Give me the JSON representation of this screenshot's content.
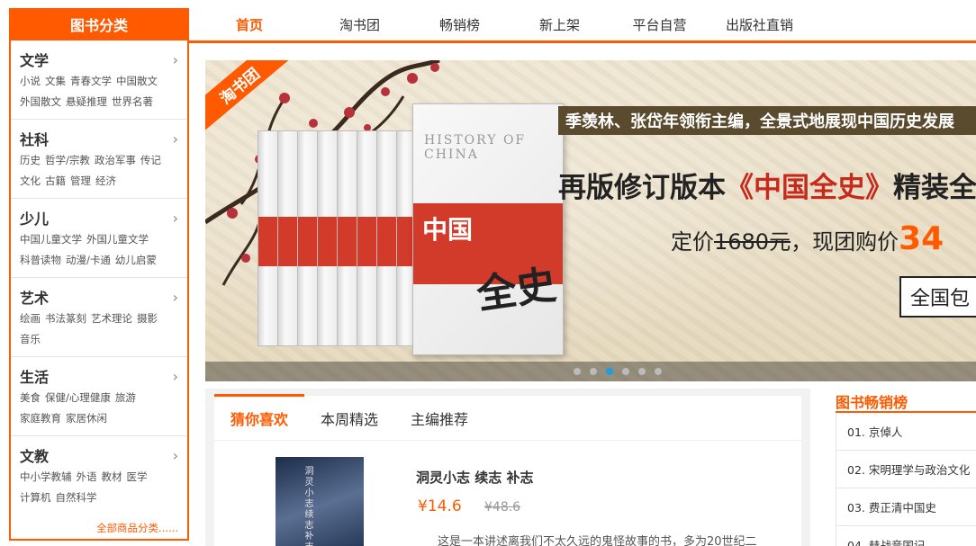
{
  "sidebar": {
    "header": "图书分类",
    "categories": [
      {
        "title": "文学",
        "links": [
          "小说",
          "文集",
          "青春文学",
          "中国散文",
          "外国散文",
          "悬疑推理",
          "世界名著"
        ]
      },
      {
        "title": "社科",
        "links": [
          "历史",
          "哲学/宗教",
          "政治军事",
          "传记",
          "文化",
          "古籍",
          "管理",
          "经济"
        ]
      },
      {
        "title": "少儿",
        "links": [
          "中国儿童文学",
          "外国儿童文学",
          "科普读物",
          "动漫/卡通",
          "幼儿启蒙"
        ]
      },
      {
        "title": "艺术",
        "links": [
          "绘画",
          "书法篆刻",
          "艺术理论",
          "摄影",
          "音乐"
        ]
      },
      {
        "title": "生活",
        "links": [
          "美食",
          "保健/心理健康",
          "旅游",
          "家庭教育",
          "家居休闲"
        ]
      },
      {
        "title": "文教",
        "links": [
          "中小学教辅",
          "外语",
          "教材",
          "医学",
          "计算机",
          "自然科学"
        ]
      }
    ],
    "all_link": "全部商品分类......"
  },
  "nav": {
    "items": [
      "首页",
      "淘书团",
      "畅销榜",
      "新上架",
      "平台自营",
      "出版社直销"
    ],
    "active_index": 0
  },
  "banner": {
    "ribbon": "淘书团",
    "line1": "季羡林、张岱年领衔主编，全景式地展现中国历史发展",
    "line2_prefix": "再版修订版本",
    "line2_title": "《中国全史》",
    "line2_suffix": "精装全",
    "line3_prefix": "定价",
    "line3_old": "1680元",
    "line3_mid": "，现团购价",
    "line3_new": "34",
    "button": "全国包",
    "book_en": "HISTORY OF CHINA",
    "book_zh": "中国",
    "book_zh2": "全史",
    "dots_count": 6,
    "active_dot": 2
  },
  "tabs": {
    "items": [
      "猜你喜欢",
      "本周精选",
      "主编推荐"
    ],
    "active_index": 0
  },
  "product": {
    "title": "洞灵小志 续志 补志",
    "price": "¥14.6",
    "old_price": "¥48.6",
    "description": "这是一本讲述离我们不太久远的鬼怪故事的书，多为20世纪二",
    "cover_text": "洞灵小志续志补志"
  },
  "bestsellers": {
    "title": "图书畅销榜",
    "items": [
      "01. 京倬人",
      "02. 宋明理学与政治文化",
      "03. 费正清中国史",
      "04. 赫战音国记"
    ]
  },
  "colors": {
    "accent": "#ff5a00",
    "banner_red": "#c62a1c"
  }
}
